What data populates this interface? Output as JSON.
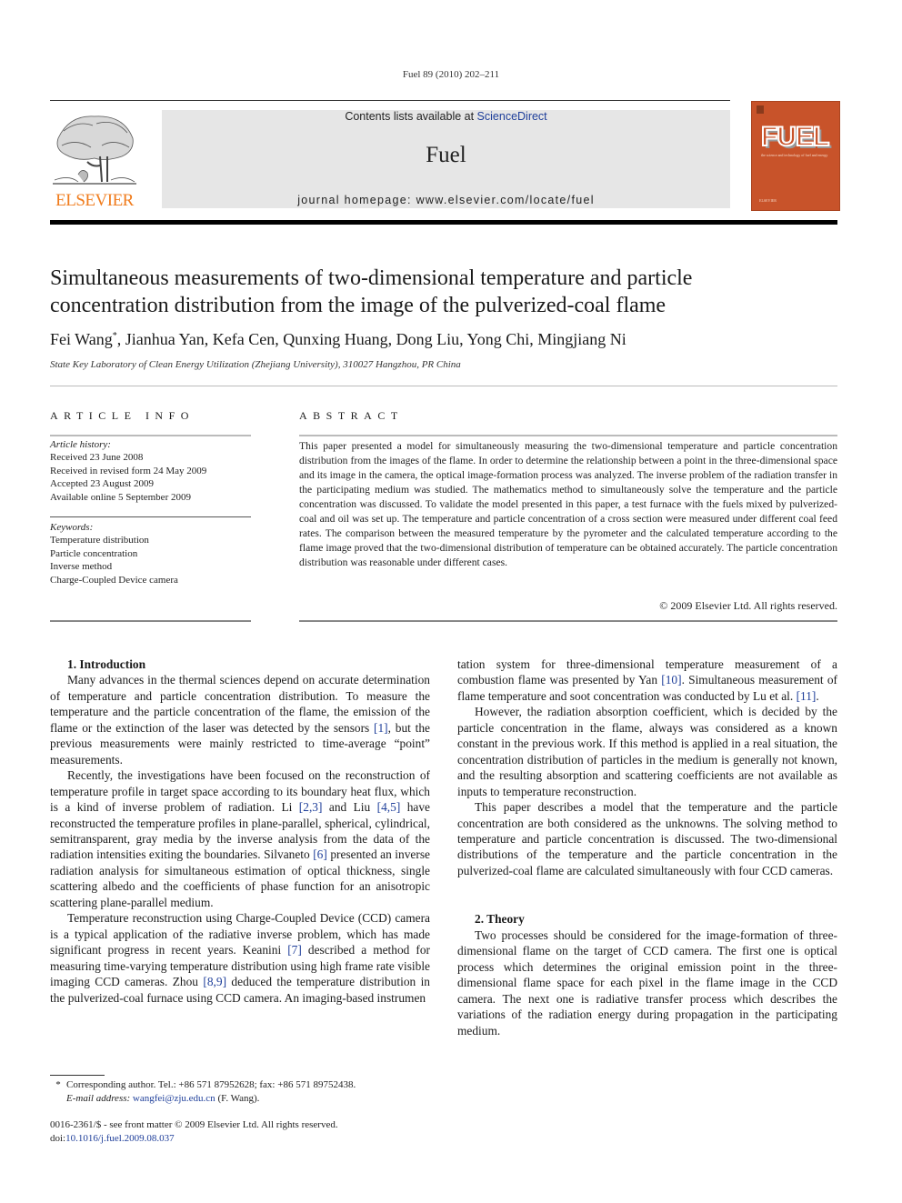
{
  "header": {
    "running_head": "Fuel 89 (2010) 202–211",
    "contents_prefix": "Contents lists available at ",
    "contents_link": "ScienceDirect",
    "journal_title": "Fuel",
    "homepage": "journal homepage: www.elsevier.com/locate/fuel",
    "publisher_logo_text": "ELSEVIER",
    "cover": {
      "title": "FUEL",
      "tagline": "the science and technology of fuel and energy",
      "publisher": "ELSEVIER"
    }
  },
  "colors": {
    "link": "#1f3f9a",
    "elsevier_orange": "#f07c1d",
    "cover_bg": "#c8532a",
    "banner_bg": "#e6e6e6"
  },
  "article": {
    "title_line1": "Simultaneous measurements of two-dimensional temperature and particle",
    "title_line2": "concentration distribution from the image of the pulverized-coal flame",
    "first_author": "Fei Wang",
    "corresponding_mark": "*",
    "other_authors": ", Jianhua Yan, Kefa Cen, Qunxing Huang, Dong Liu, Yong Chi, Mingjiang Ni",
    "affiliation": "State Key Laboratory of Clean Energy Utilization (Zhejiang University), 310027 Hangzhou, PR China"
  },
  "article_info": {
    "heading": "ARTICLE INFO",
    "history_label": "Article history:",
    "history": [
      "Received 23 June 2008",
      "Received in revised form 24 May 2009",
      "Accepted 23 August 2009",
      "Available online 5 September 2009"
    ],
    "keywords_label": "Keywords:",
    "keywords": [
      "Temperature distribution",
      "Particle concentration",
      "Inverse method",
      "Charge-Coupled Device camera"
    ]
  },
  "abstract": {
    "heading": "ABSTRACT",
    "text": "This paper presented a model for simultaneously measuring the two-dimensional temperature and particle concentration distribution from the images of the flame. In order to determine the relationship between a point in the three-dimensional space and its image in the camera, the optical image-formation process was analyzed. The inverse problem of the radiation transfer in the participating medium was studied. The mathematics method to simultaneously solve the temperature and the particle concentration was discussed. To validate the model presented in this paper, a test furnace with the fuels mixed by pulverized-coal and oil was set up. The temperature and particle concentration of a cross section were measured under different coal feed rates. The comparison between the measured temperature by the pyrometer and the calculated temperature according to the flame image proved that the two-dimensional distribution of temperature can be obtained accurately. The particle concentration distribution was reasonable under different cases.",
    "copyright": "© 2009 Elsevier Ltd. All rights reserved."
  },
  "body": {
    "section1_heading": "1. Introduction",
    "p1": {
      "a": "Many advances in the thermal sciences depend on accurate determination of temperature and particle concentration distribution. To measure the temperature and the particle concentration of the flame, the emission of the flame or the extinction of the laser was detected by the sensors ",
      "r1": "[1]",
      "b": ", but the previous measurements were mainly restricted to time-average “point” measurements."
    },
    "p2": {
      "a": "Recently, the investigations have been focused on the reconstruction of temperature profile in target space according to its boundary heat flux, which is a kind of inverse problem of radiation. Li ",
      "r1": "[2,3]",
      "b": " and Liu ",
      "r2": "[4,5]",
      "c": " have reconstructed the temperature profiles in plane-parallel, spherical, cylindrical, semitransparent, gray media by the inverse analysis from the data of the radiation intensities exiting the boundaries. Silvaneto ",
      "r3": "[6]",
      "d": " presented an inverse radiation analysis for simultaneous estimation of optical thickness, single scattering albedo and the coefficients of phase function for an anisotropic scattering plane-parallel medium."
    },
    "p3": {
      "a": "Temperature reconstruction using Charge-Coupled Device (CCD) camera is a typical application of the radiative inverse problem, which has made significant progress in recent years. Keanini ",
      "r1": "[7]",
      "b": " described a method for measuring time-varying temperature distribution using high frame rate visible imaging CCD cameras. Zhou ",
      "r2": "[8,9]",
      "c": " deduced the temperature distribution in the pulverized-coal furnace using CCD camera. An imaging-based instrumen"
    },
    "p3_cont": {
      "a": "tation system for three-dimensional temperature measurement of a combustion flame was presented by Yan ",
      "r1": "[10]",
      "b": ". Simultaneous measurement of flame temperature and soot concentration was conducted by Lu et al. ",
      "r2": "[11]",
      "c": "."
    },
    "p4": "However, the radiation absorption coefficient, which is decided by the particle concentration in the flame, always was considered as a known constant in the previous work. If this method is applied in a real situation, the concentration distribution of particles in the medium is generally not known, and the resulting absorption and scattering coefficients are not available as inputs to temperature reconstruction.",
    "p5": "This paper describes a model that the temperature and the particle concentration are both considered as the unknowns. The solving method to temperature and particle concentration is discussed. The two-dimensional distributions of the temperature and the particle concentration in the pulverized-coal flame are calculated simultaneously with four CCD cameras.",
    "section2_heading": "2. Theory",
    "p6": "Two processes should be considered for the image-formation of three-dimensional flame on the target of CCD camera. The first one is optical process which determines the original emission point in the three-dimensional flame space for each pixel in the flame image in the CCD camera. The next one is radiative transfer process which describes the variations of the radiation energy during propagation in the participating medium."
  },
  "footnote": {
    "mark": "*",
    "line1": "Corresponding author. Tel.: +86 571 87952628; fax: +86 571 89752438.",
    "email_label": "E-mail address: ",
    "email": "wangfei@zju.edu.cn",
    "email_suffix": " (F. Wang)."
  },
  "front_matter": {
    "issn_line": "0016-2361/$ - see front matter © 2009 Elsevier Ltd. All rights reserved.",
    "doi_prefix": "doi:",
    "doi": "10.1016/j.fuel.2009.08.037"
  }
}
